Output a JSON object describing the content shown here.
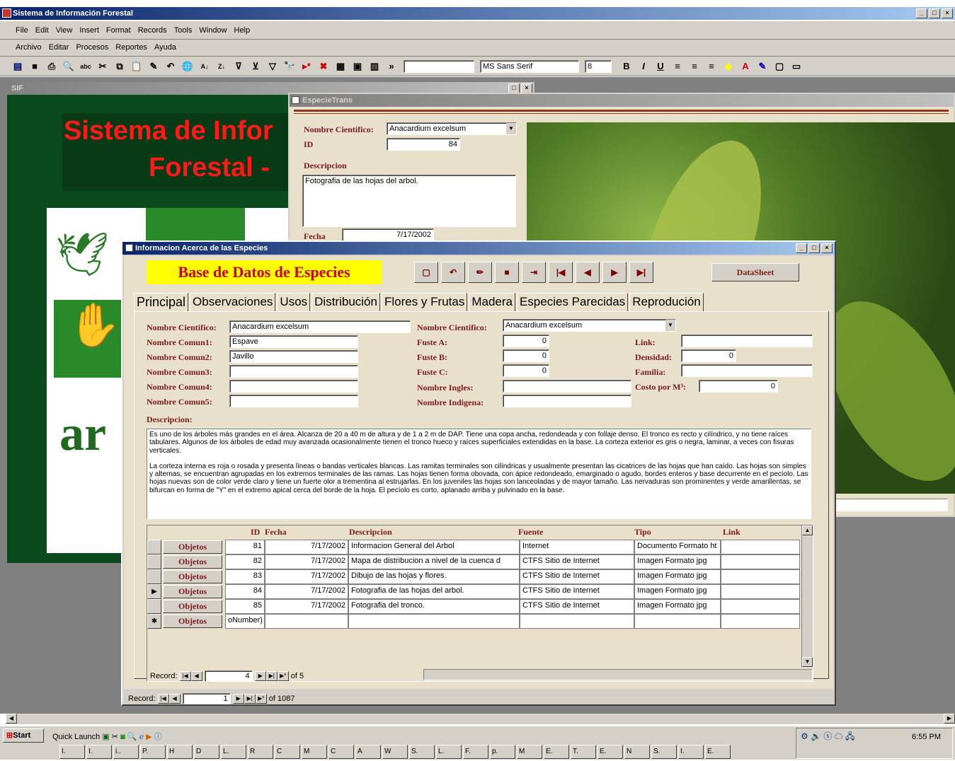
{
  "app": {
    "title": "Sistema de Información Forestal"
  },
  "menu1": [
    "File",
    "Edit",
    "View",
    "Insert",
    "Format",
    "Records",
    "Tools",
    "Window",
    "Help"
  ],
  "menu2": [
    "Archivo",
    "Editar",
    "Procesos",
    "Reportes",
    "Ayuda"
  ],
  "toolbar": {
    "font_name": "MS Sans Serif",
    "font_size": "8"
  },
  "sif": {
    "title": "SIF",
    "heading_line1": "Sistema de Infor",
    "heading_line2": "Forestal -",
    "logo_text": "ar"
  },
  "especie_trans": {
    "title": "EspecieTrans",
    "nombre_label": "Nombre Científico:",
    "nombre_value": "Anacardium excelsum",
    "id_label": "ID",
    "id_value": "84",
    "desc_label": "Descripcion",
    "desc_value": "Fotografia de las hojas del arbol.",
    "fecha_label": "Fecha",
    "fecha_value": "7/17/2002"
  },
  "info": {
    "title": "Informacion Acerca de las Especies",
    "banner": "Base de Datos de Especies",
    "datasheet_label": "DataSheet",
    "tabs": [
      "Principal",
      "Observaciones",
      "Usos",
      "Distribución",
      "Flores y Frutas",
      "Madera",
      "Especies Parecidas",
      "Reprodución"
    ],
    "labels": {
      "nombre_cientifico": "Nombre Cientifico:",
      "nombre_comun1": "Nombre Comun1:",
      "nombre_comun2": "Nombre Comun2:",
      "nombre_comun3": "Nombre Comun3:",
      "nombre_comun4": "Nombre Comun4:",
      "nombre_comun5": "Nombre Comun5:",
      "nombre_cientifico2": "Nombre Cientifico:",
      "fuste_a": "Fuste A:",
      "fuste_b": "Fuste B:",
      "fuste_c": "Fuste C:",
      "nombre_ingles": "Nombre Ingles:",
      "nombre_indigena": "Nombre Indigena:",
      "link": "Link:",
      "densidad": "Densidad:",
      "familia": "Familia:",
      "costo": "Costo por M³:",
      "descripcion": "Descripcion:"
    },
    "values": {
      "nombre_cientifico": "Anacardium excelsum",
      "nombre_comun1": "Espave",
      "nombre_comun2": "Javillo",
      "nombre_comun3": "",
      "nombre_comun4": "",
      "nombre_comun5": "",
      "nombre_cientifico2": "Anacardium excelsum",
      "fuste_a": "0",
      "fuste_b": "0",
      "fuste_c": "0",
      "nombre_ingles": "",
      "nombre_indigena": "",
      "link": "",
      "densidad": "0",
      "familia": "",
      "costo": "0"
    },
    "descripcion_p1": "Es uno de los árboles más grandes en el área.   Alcanza de 20 a 40 m de altura y de 1 a 2 m de DAP.   Tiene una copa ancha, redondeada y con follaje denso. El tronco es recto y cilíndrico, y no tiene raíces tabulares. Algunos de los árboles de edad muy avanzada ocasionalmente tienen el tronco hueco y raíces superficiales extendidas en la base. La corteza exterior es gris o negra, laminar, a veces con fisuras verticales.",
    "descripcion_p2": "La corteza interna es roja o rosada y presenta líneas o bandas verticales blancas. Las ramitas terminales son cilíndricas y usualmente presentan las cicatrices de las hojas que han caído. Las hojas son simples y alternas, se encuentran agrupadas en los extremos terminales de las ramas. Las hojas tienen forma obovada, con ápice redondeado, emarginado o agudo, bordes enteros y base decurrente en el pecíolo. Las hojas nuevas son de color verde claro y tiene un fuerte olor a trementina al estrujarlas. En los juveniles las hojas son lanceoladas y de mayor tamaño. Las nervaduras son prominentes y verde amarillentas, se bifurcan en forma de \"Y\" en el extremo apical cerca del borde de la hoja. El pecíolo es corto, aplanado arriba y pulvinado en la base.",
    "grid": {
      "headers": [
        "ID",
        "Fecha",
        "Descripcion",
        "Fuente",
        "Tipo",
        "Link"
      ],
      "button_label": "Objetos",
      "rows": [
        {
          "id": "81",
          "fecha": "7/17/2002",
          "desc": "Informacion General del Arbol",
          "fuente": "Internet",
          "tipo": "Documento Formato ht",
          "link": ""
        },
        {
          "id": "82",
          "fecha": "7/17/2002",
          "desc": "Mapa de distribucion a nivel de la cuenca d",
          "fuente": "CTFS Sitio de Internet",
          "tipo": "Imagen Formato jpg",
          "link": ""
        },
        {
          "id": "83",
          "fecha": "7/17/2002",
          "desc": "Dibujo de las hojas y flores.",
          "fuente": "CTFS Sitio de Internet",
          "tipo": "Imagen Formato jpg",
          "link": ""
        },
        {
          "id": "84",
          "fecha": "7/17/2002",
          "desc": "Fotografia de las hojas del arbol.",
          "fuente": "CTFS Sitio de Internet",
          "tipo": "Imagen Formato jpg",
          "link": ""
        },
        {
          "id": "85",
          "fecha": "7/17/2002",
          "desc": "Fotografia del tronco.",
          "fuente": "CTFS Sitio de Internet",
          "tipo": "Imagen Formato jpg",
          "link": ""
        }
      ],
      "new_row_id": "oNumber)"
    },
    "sub_record": {
      "label": "Record:",
      "current": "4",
      "of": "of 5"
    },
    "main_record": {
      "label": "Record:",
      "current": "1",
      "of": "of 1087"
    }
  },
  "taskbar": {
    "start": "Start",
    "quick_launch": "Quick Launch",
    "clock": "6:55 PM",
    "tasks": [
      "I.",
      "I.",
      "i..",
      "P.",
      "H",
      "D",
      "L.",
      "R",
      "C",
      "M",
      "C",
      "A",
      "W",
      "S.",
      "L.",
      "F.",
      "p.",
      "M",
      "E.",
      "T.",
      "E.",
      "N",
      "S.",
      "I.",
      "E."
    ]
  },
  "colors": {
    "accent": "#0a246a",
    "form_bg": "#e9e0cc",
    "label": "#7a1c1c",
    "banner_bg": "#ffff00",
    "banner_text": "#cc0000",
    "sif_bg": "#0a4a1c"
  }
}
